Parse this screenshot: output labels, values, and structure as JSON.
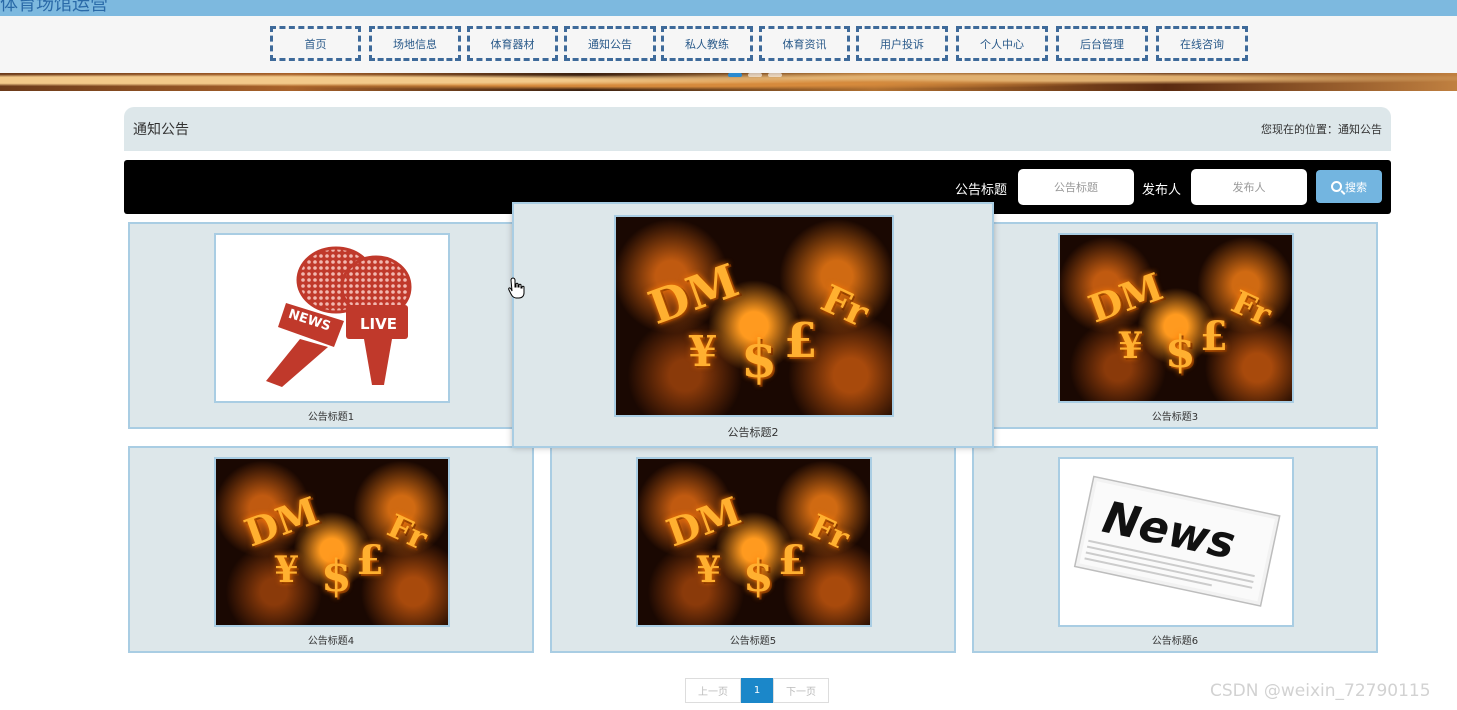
{
  "site": {
    "title": "体育场馆运营"
  },
  "nav": {
    "items": [
      {
        "label": "首页",
        "name": "nav-home"
      },
      {
        "label": "场地信息",
        "name": "nav-venue-info"
      },
      {
        "label": "体育器材",
        "name": "nav-equipment"
      },
      {
        "label": "通知公告",
        "name": "nav-notices"
      },
      {
        "label": "私人教练",
        "name": "nav-personal-coach"
      },
      {
        "label": "体育资讯",
        "name": "nav-sports-news"
      },
      {
        "label": "用户投诉",
        "name": "nav-complaints"
      },
      {
        "label": "个人中心",
        "name": "nav-personal-center"
      },
      {
        "label": "后台管理",
        "name": "nav-admin"
      },
      {
        "label": "在线咨询",
        "name": "nav-online-consult"
      }
    ]
  },
  "banner": {
    "slide_count": 3,
    "active_slide": 1
  },
  "section": {
    "title": "通知公告",
    "location": "您现在的位置：通知公告"
  },
  "search": {
    "title_label": "公告标题",
    "title_placeholder": "公告标题",
    "publisher_label": "发布人",
    "publisher_placeholder": "发布人",
    "button_label": "搜索"
  },
  "cards": [
    {
      "caption": "公告标题1",
      "image": "news-microphone"
    },
    {
      "caption": "公告标题2",
      "image": "currency-symbols"
    },
    {
      "caption": "公告标题3",
      "image": "currency-symbols"
    },
    {
      "caption": "公告标题4",
      "image": "currency-symbols"
    },
    {
      "caption": "公告标题5",
      "image": "currency-symbols"
    },
    {
      "caption": "公告标题6",
      "image": "newspaper"
    }
  ],
  "money_image": {
    "symbols": [
      "DM",
      "¥",
      "$",
      "£",
      "Fr"
    ]
  },
  "mic_image": {
    "label_news": "NEWS",
    "label_live": "LIVE"
  },
  "paper_image": {
    "headline": "News"
  },
  "pagination": {
    "prev": "上一页",
    "current": "1",
    "next": "下一页"
  },
  "watermark": "CSDN @weixin_72790115",
  "colors": {
    "nav_border": "#3e6a9a",
    "card_bg": "#dde7ea",
    "card_border": "#a9cde3",
    "accent": "#1b87c9",
    "search_button": "#73b5e0"
  }
}
